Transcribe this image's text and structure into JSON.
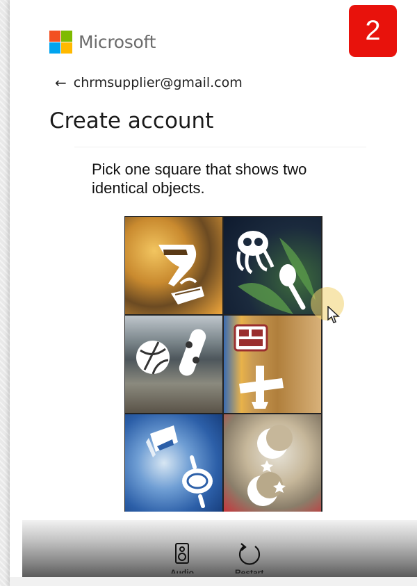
{
  "badge": {
    "number": "2",
    "color": "#e8120c"
  },
  "brand": {
    "name": "Microsoft",
    "logo_colors": [
      "#f25022",
      "#7fba00",
      "#00a4ef",
      "#ffb900"
    ]
  },
  "account": {
    "back_icon": "arrow-left-icon",
    "email": "chrmsupplier@gmail.com"
  },
  "page": {
    "title": "Create account"
  },
  "captcha": {
    "prompt": "Pick one square that shows two identical objects.",
    "tiles": [
      {
        "id": "tile-1",
        "objects": [
          "ice-cream-cone",
          "basket"
        ]
      },
      {
        "id": "tile-2",
        "objects": [
          "octopus",
          "spoon"
        ]
      },
      {
        "id": "tile-3",
        "objects": [
          "volleyball",
          "snowboard"
        ]
      },
      {
        "id": "tile-4",
        "objects": [
          "cash-register",
          "plunger"
        ]
      },
      {
        "id": "tile-5",
        "objects": [
          "cube-shape",
          "rolling-pin"
        ]
      },
      {
        "id": "tile-6",
        "objects": [
          "moon-and-star",
          "moon-and-star"
        ]
      }
    ],
    "controls": [
      {
        "name": "audio-button",
        "label": "Audio",
        "icon": "speaker-icon"
      },
      {
        "name": "restart-button",
        "label": "Restart",
        "icon": "restart-icon"
      }
    ]
  }
}
